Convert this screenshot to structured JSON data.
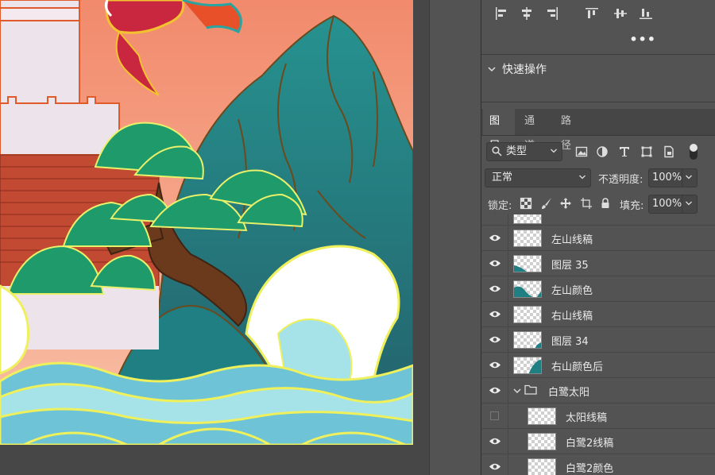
{
  "canvas": {
    "description_colors": {
      "sky_top": "#f28a6c",
      "sky_bottom": "#f7b49d",
      "mountain": "#2a8f8c",
      "wave": "#a6e3e8",
      "pine": "#1f9a6b"
    }
  },
  "panel": {
    "align_icons": [
      "align-left-icon",
      "align-hcenter-icon",
      "align-right-icon",
      "align-top-icon",
      "align-vcenter-icon",
      "align-bottom-icon"
    ],
    "more_label": "•••",
    "quick_actions_label": "快速操作",
    "tabs": [
      {
        "label": "图层",
        "active": true
      },
      {
        "label": "通道",
        "active": false
      },
      {
        "label": "路径",
        "active": false
      }
    ],
    "filter_label": "类型",
    "blend_mode": "正常",
    "opacity_label": "不透明度:",
    "opacity_value": "100%",
    "lock_label": "锁定:",
    "fill_label": "填充:",
    "fill_value": "100%",
    "layers": [
      {
        "name": "左山线稿",
        "visible": true,
        "thumb": "empty"
      },
      {
        "name": "图层 35",
        "visible": true,
        "thumb": "teal-corner"
      },
      {
        "name": "左山颜色",
        "visible": true,
        "thumb": "teal-left"
      },
      {
        "name": "右山线稿",
        "visible": true,
        "thumb": "empty"
      },
      {
        "name": "图层 34",
        "visible": true,
        "thumb": "teal-dot"
      },
      {
        "name": "右山颜色后",
        "visible": true,
        "thumb": "teal-right"
      },
      {
        "name": "白鹭太阳",
        "visible": true,
        "thumb": "folder"
      },
      {
        "name": "太阳线稿",
        "visible": false,
        "thumb": "empty"
      },
      {
        "name": "白鹭2线稿",
        "visible": true,
        "thumb": "empty"
      },
      {
        "name": "白鹭2颜色",
        "visible": true,
        "thumb": "empty"
      }
    ]
  }
}
